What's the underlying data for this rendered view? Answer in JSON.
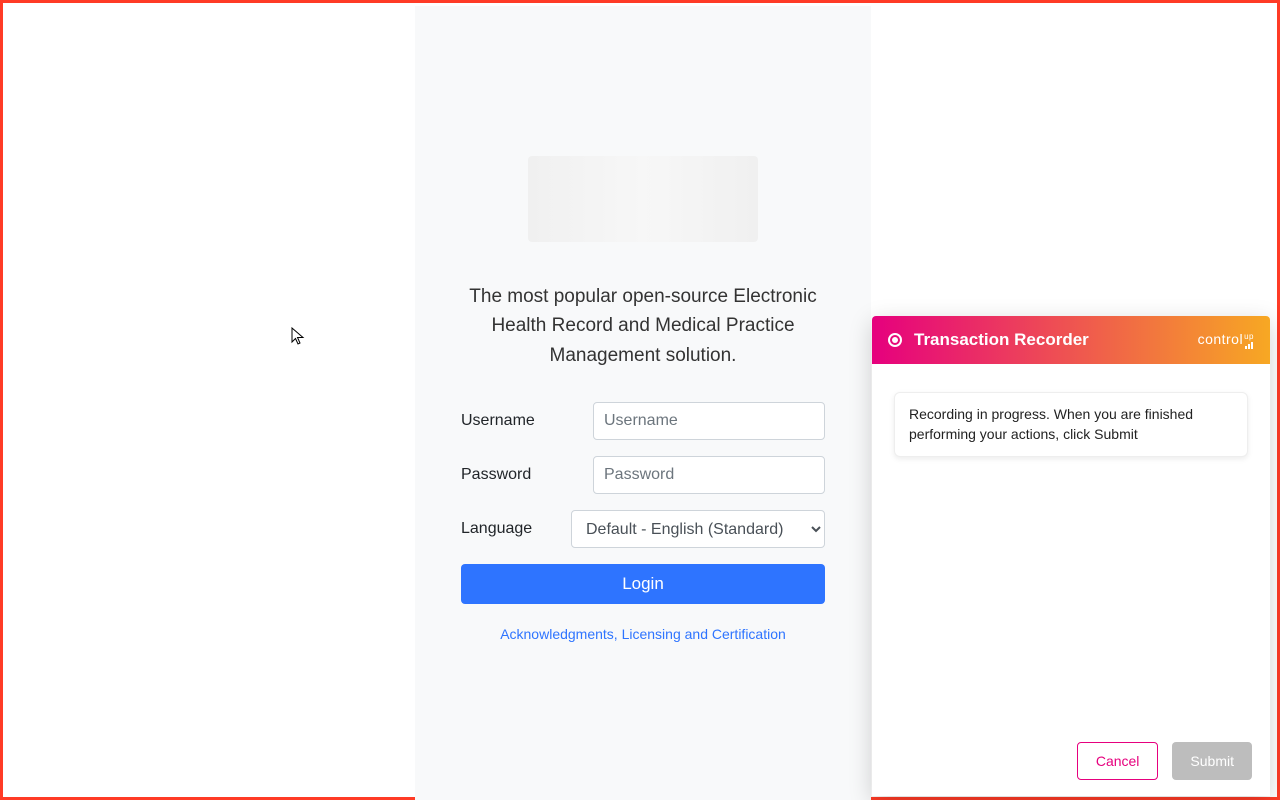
{
  "login": {
    "tagline": "The most popular open-source Electronic Health Record and Medical Practice Management solution.",
    "username_label": "Username",
    "username_placeholder": "Username",
    "password_label": "Password",
    "password_placeholder": "Password",
    "language_label": "Language",
    "language_selected": "Default - English (Standard)",
    "login_button": "Login",
    "ack_link": "Acknowledgments, Licensing and Certification"
  },
  "recorder": {
    "title": "Transaction Recorder",
    "brand": "control",
    "brand_suffix": "up",
    "status": "Recording in progress. When you are finished performing your actions, click Submit",
    "cancel": "Cancel",
    "submit": "Submit"
  },
  "colors": {
    "frame_border": "#ff3b26",
    "primary_button": "#2e74ff",
    "recorder_gradient_from": "#e6007e",
    "recorder_gradient_to": "#f7a823",
    "submit_disabled": "#bdbdbd"
  }
}
